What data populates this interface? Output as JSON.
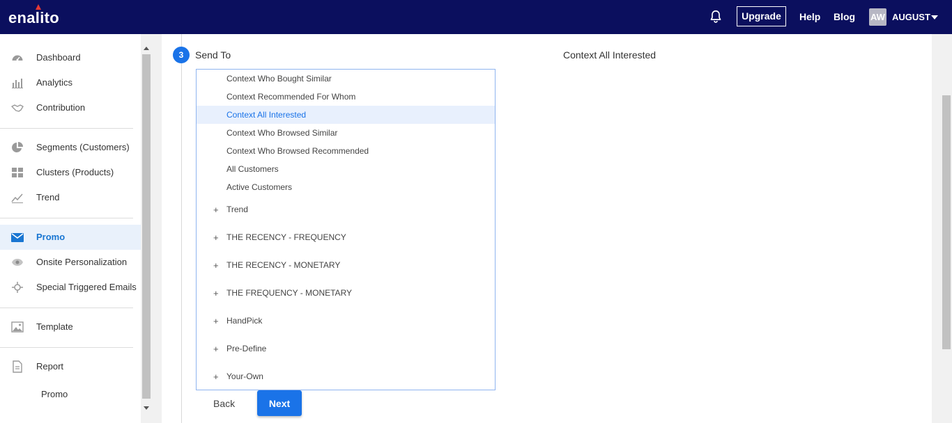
{
  "app": {
    "logo": "enalito"
  },
  "header": {
    "upgrade_label": "Upgrade",
    "help_label": "Help",
    "blog_label": "Blog",
    "avatar_initials": "AW",
    "user_name": "AUGUST",
    "icons": {
      "notifications": "bell-icon",
      "user_menu": "caret-down-icon"
    }
  },
  "sidebar": {
    "items": [
      {
        "label": "Dashboard",
        "icon": "dashboard-icon"
      },
      {
        "label": "Analytics",
        "icon": "bar-chart-icon"
      },
      {
        "label": "Contribution",
        "icon": "handshake-icon"
      },
      {
        "label": "Segments (Customers)",
        "icon": "pie-chart-icon"
      },
      {
        "label": "Clusters (Products)",
        "icon": "grid-icon"
      },
      {
        "label": "Trend",
        "icon": "trend-line-icon"
      },
      {
        "label": "Promo",
        "icon": "envelope-icon",
        "active": true
      },
      {
        "label": "Onsite Personalization",
        "icon": "eye-icon"
      },
      {
        "label": "Special Triggered Emails",
        "icon": "crosshair-icon"
      },
      {
        "label": "Template",
        "icon": "image-icon"
      },
      {
        "label": "Report",
        "icon": "document-icon"
      }
    ],
    "sub_items": [
      {
        "label": "Promo"
      }
    ],
    "active_color": "#1976d2"
  },
  "step": {
    "number": "3",
    "title": "Send To",
    "selected_value": "Context All Interested"
  },
  "send_to_list": {
    "options": [
      {
        "label": "Context Who Bought Similar"
      },
      {
        "label": "Context Recommended For Whom"
      },
      {
        "label": "Context All Interested",
        "selected": true
      },
      {
        "label": "Context Who Browsed Similar"
      },
      {
        "label": "Context Who Browsed Recommended"
      },
      {
        "label": "All Customers"
      },
      {
        "label": "Active Customers"
      }
    ],
    "groups": [
      {
        "toggle": "+",
        "label": "Trend"
      },
      {
        "toggle": "+",
        "label": "THE RECENCY - FREQUENCY"
      },
      {
        "toggle": "+",
        "label": "THE RECENCY - MONETARY"
      },
      {
        "toggle": "+",
        "label": "THE FREQUENCY - MONETARY"
      },
      {
        "toggle": "+",
        "label": "HandPick"
      },
      {
        "toggle": "+",
        "label": "Pre-Define"
      },
      {
        "toggle": "+",
        "label": "Your-Own"
      }
    ]
  },
  "actions": {
    "back_label": "Back",
    "next_label": "Next"
  },
  "colors": {
    "header_bg": "#0b0f5e",
    "accent": "#1a73e8",
    "selected_bg": "#e8f0fd"
  }
}
